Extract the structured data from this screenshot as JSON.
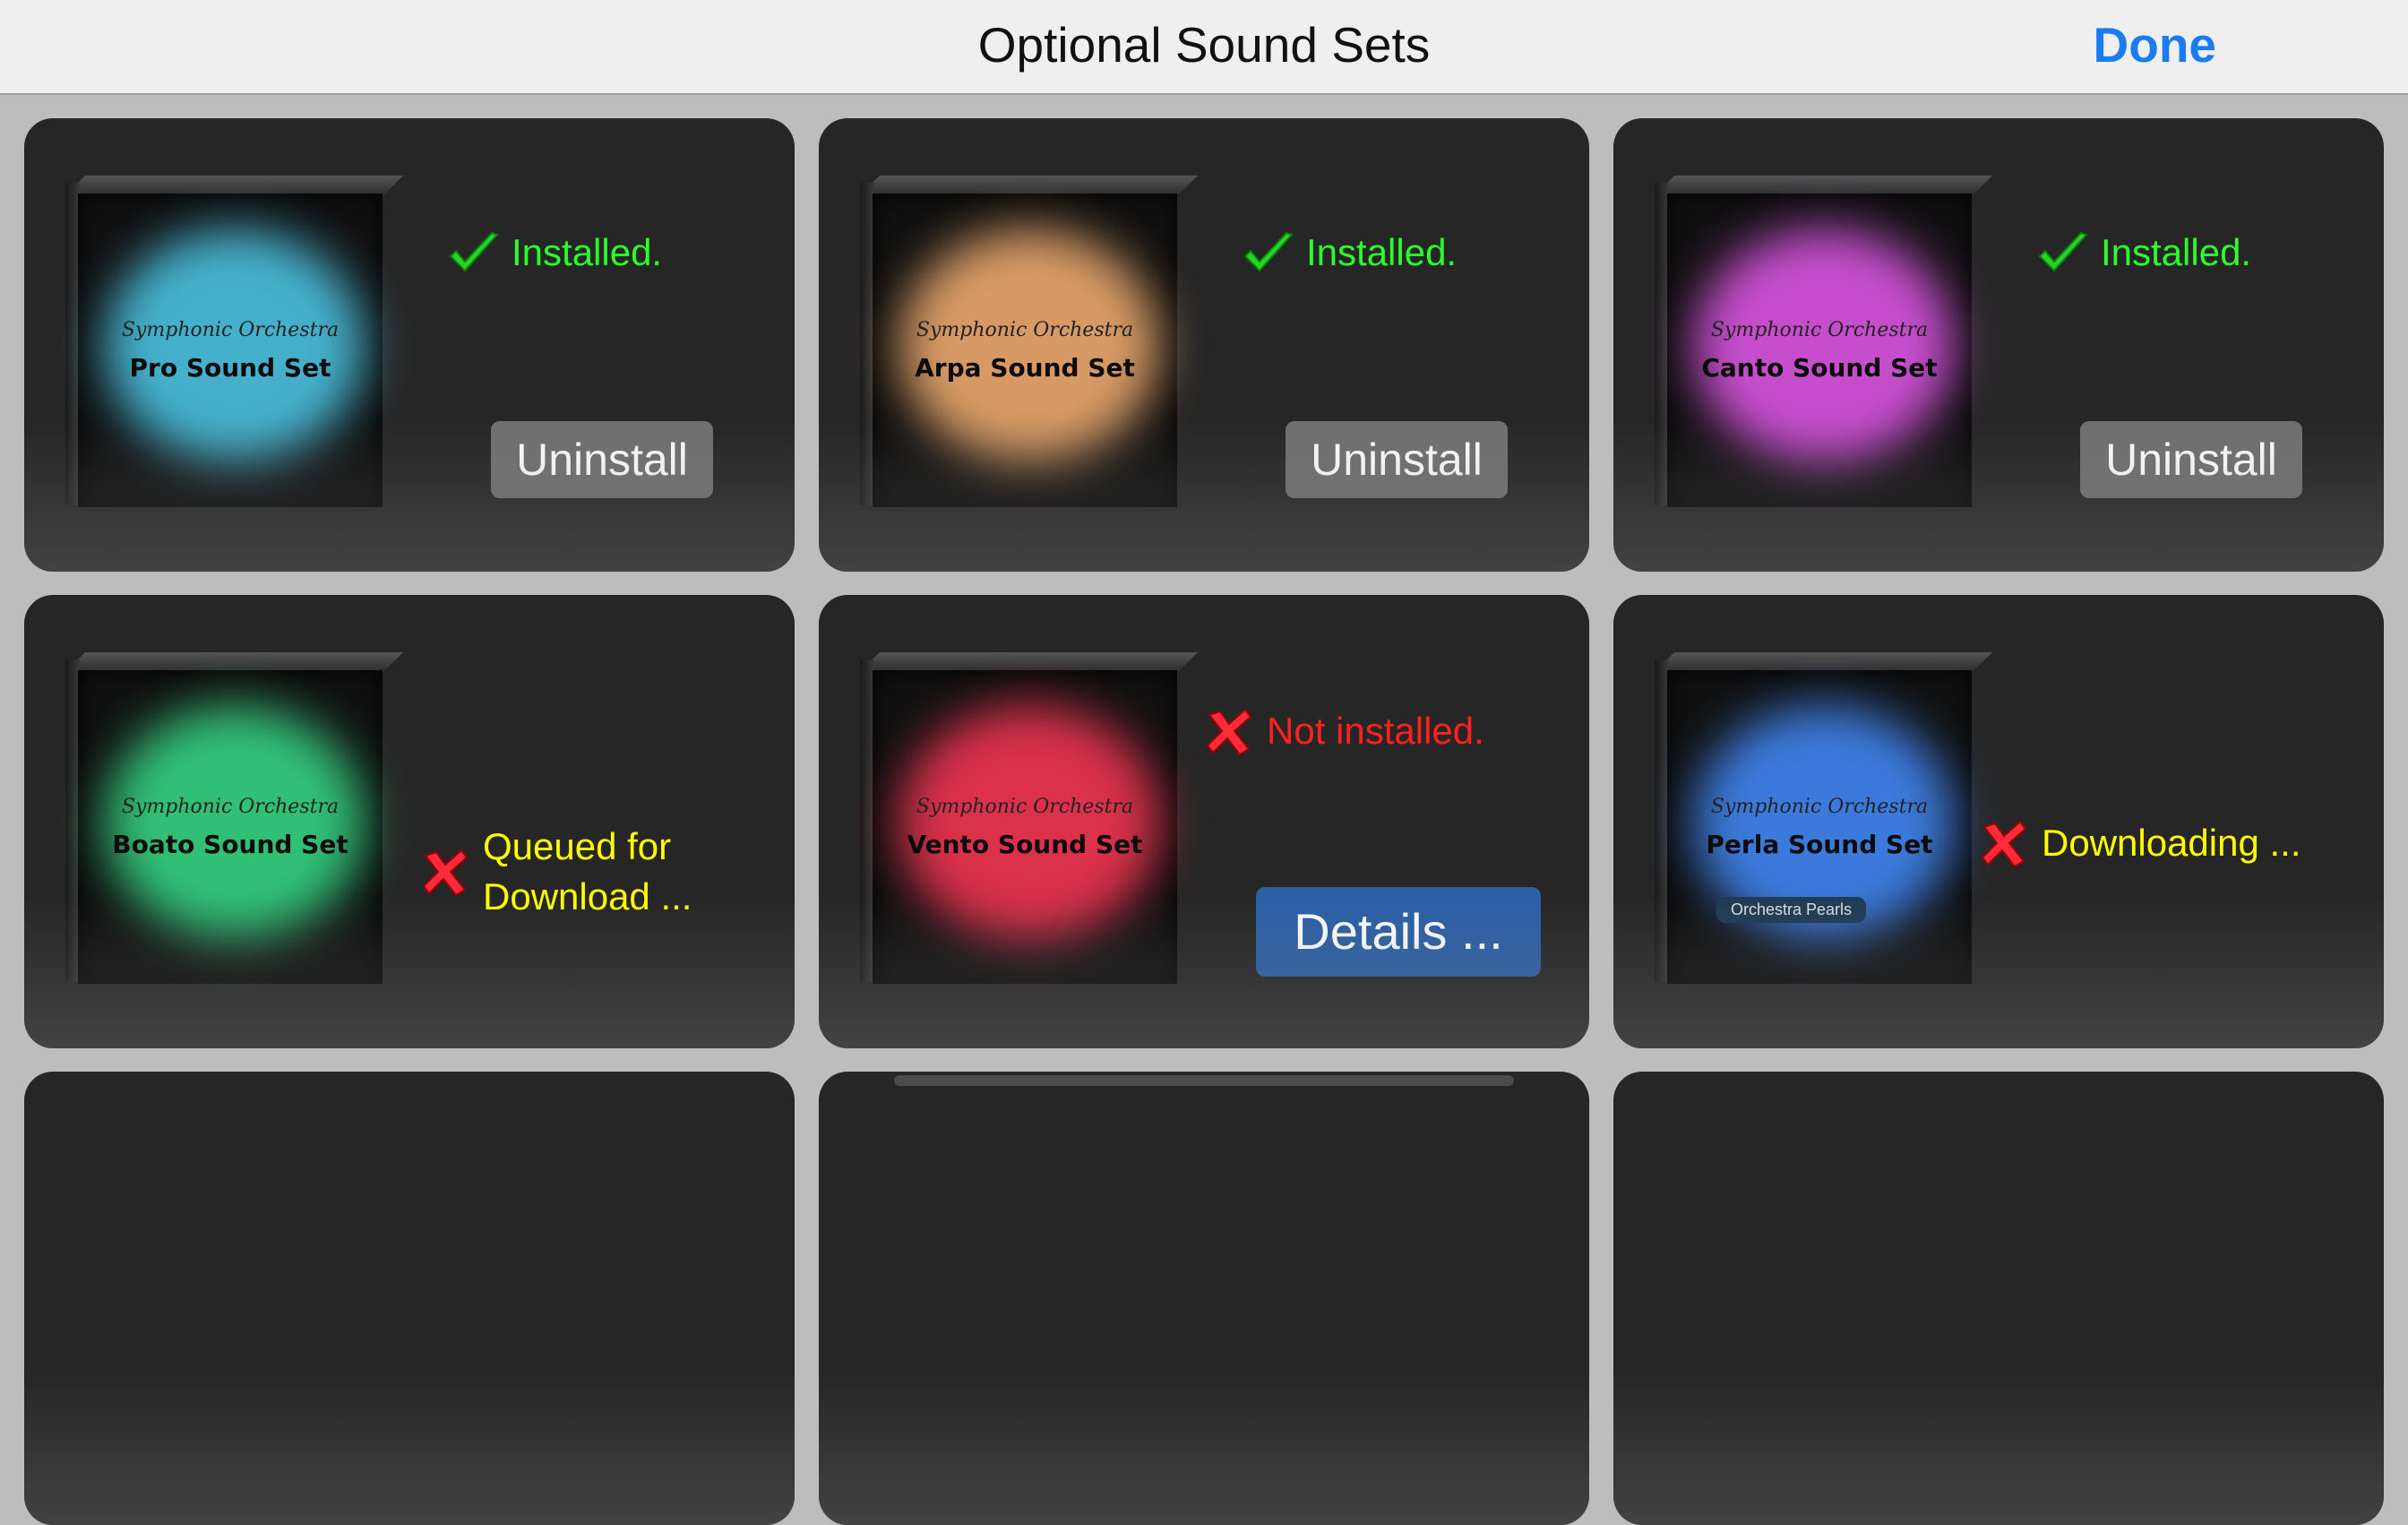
{
  "navbar": {
    "title": "Optional Sound Sets",
    "done_label": "Done",
    "accent_color": "#1a7cf0"
  },
  "box_subtitle": "Symphonic Orchestra",
  "sets": [
    {
      "name": "Pro Sound Set",
      "glow": "#48b9d6",
      "status": "installed",
      "status_text": "Installed.",
      "status_color": "#2cff2c",
      "action": "Uninstall"
    },
    {
      "name": "Arpa Sound Set",
      "glow": "#e2a26a",
      "status": "installed",
      "status_text": "Installed.",
      "status_color": "#2cff2c",
      "action": "Uninstall"
    },
    {
      "name": "Canto Sound Set",
      "glow": "#d052d8",
      "status": "installed",
      "status_text": "Installed.",
      "status_color": "#2cff2c",
      "action": "Uninstall"
    },
    {
      "name": "Boato Sound Set",
      "glow": "#33c97b",
      "status": "queued",
      "status_text": "Queued for Download ...",
      "status_color": "#ffff00",
      "action": ""
    },
    {
      "name": "Vento Sound Set",
      "glow": "#e6334e",
      "status": "not-installed",
      "status_text": "Not installed.",
      "status_color": "#ff2020",
      "action": "Details ..."
    },
    {
      "name": "Perla Sound Set",
      "glow": "#3e80e6",
      "status": "downloading",
      "status_text": "Downloading ...",
      "status_color": "#ffff00",
      "action": "",
      "tag": "Orchestra Pearls"
    }
  ],
  "icons": {
    "installed": "checkmark-icon",
    "not_installed": "cross-icon"
  }
}
